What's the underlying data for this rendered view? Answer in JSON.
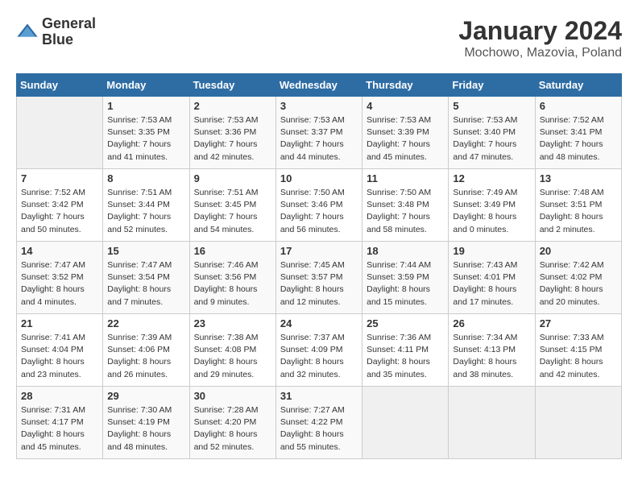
{
  "header": {
    "logo_line1": "General",
    "logo_line2": "Blue",
    "month": "January 2024",
    "location": "Mochowo, Mazovia, Poland"
  },
  "weekdays": [
    "Sunday",
    "Monday",
    "Tuesday",
    "Wednesday",
    "Thursday",
    "Friday",
    "Saturday"
  ],
  "weeks": [
    [
      {
        "day": "",
        "info": ""
      },
      {
        "day": "1",
        "info": "Sunrise: 7:53 AM\nSunset: 3:35 PM\nDaylight: 7 hours\nand 41 minutes."
      },
      {
        "day": "2",
        "info": "Sunrise: 7:53 AM\nSunset: 3:36 PM\nDaylight: 7 hours\nand 42 minutes."
      },
      {
        "day": "3",
        "info": "Sunrise: 7:53 AM\nSunset: 3:37 PM\nDaylight: 7 hours\nand 44 minutes."
      },
      {
        "day": "4",
        "info": "Sunrise: 7:53 AM\nSunset: 3:39 PM\nDaylight: 7 hours\nand 45 minutes."
      },
      {
        "day": "5",
        "info": "Sunrise: 7:53 AM\nSunset: 3:40 PM\nDaylight: 7 hours\nand 47 minutes."
      },
      {
        "day": "6",
        "info": "Sunrise: 7:52 AM\nSunset: 3:41 PM\nDaylight: 7 hours\nand 48 minutes."
      }
    ],
    [
      {
        "day": "7",
        "info": "Sunrise: 7:52 AM\nSunset: 3:42 PM\nDaylight: 7 hours\nand 50 minutes."
      },
      {
        "day": "8",
        "info": "Sunrise: 7:51 AM\nSunset: 3:44 PM\nDaylight: 7 hours\nand 52 minutes."
      },
      {
        "day": "9",
        "info": "Sunrise: 7:51 AM\nSunset: 3:45 PM\nDaylight: 7 hours\nand 54 minutes."
      },
      {
        "day": "10",
        "info": "Sunrise: 7:50 AM\nSunset: 3:46 PM\nDaylight: 7 hours\nand 56 minutes."
      },
      {
        "day": "11",
        "info": "Sunrise: 7:50 AM\nSunset: 3:48 PM\nDaylight: 7 hours\nand 58 minutes."
      },
      {
        "day": "12",
        "info": "Sunrise: 7:49 AM\nSunset: 3:49 PM\nDaylight: 8 hours\nand 0 minutes."
      },
      {
        "day": "13",
        "info": "Sunrise: 7:48 AM\nSunset: 3:51 PM\nDaylight: 8 hours\nand 2 minutes."
      }
    ],
    [
      {
        "day": "14",
        "info": "Sunrise: 7:47 AM\nSunset: 3:52 PM\nDaylight: 8 hours\nand 4 minutes."
      },
      {
        "day": "15",
        "info": "Sunrise: 7:47 AM\nSunset: 3:54 PM\nDaylight: 8 hours\nand 7 minutes."
      },
      {
        "day": "16",
        "info": "Sunrise: 7:46 AM\nSunset: 3:56 PM\nDaylight: 8 hours\nand 9 minutes."
      },
      {
        "day": "17",
        "info": "Sunrise: 7:45 AM\nSunset: 3:57 PM\nDaylight: 8 hours\nand 12 minutes."
      },
      {
        "day": "18",
        "info": "Sunrise: 7:44 AM\nSunset: 3:59 PM\nDaylight: 8 hours\nand 15 minutes."
      },
      {
        "day": "19",
        "info": "Sunrise: 7:43 AM\nSunset: 4:01 PM\nDaylight: 8 hours\nand 17 minutes."
      },
      {
        "day": "20",
        "info": "Sunrise: 7:42 AM\nSunset: 4:02 PM\nDaylight: 8 hours\nand 20 minutes."
      }
    ],
    [
      {
        "day": "21",
        "info": "Sunrise: 7:41 AM\nSunset: 4:04 PM\nDaylight: 8 hours\nand 23 minutes."
      },
      {
        "day": "22",
        "info": "Sunrise: 7:39 AM\nSunset: 4:06 PM\nDaylight: 8 hours\nand 26 minutes."
      },
      {
        "day": "23",
        "info": "Sunrise: 7:38 AM\nSunset: 4:08 PM\nDaylight: 8 hours\nand 29 minutes."
      },
      {
        "day": "24",
        "info": "Sunrise: 7:37 AM\nSunset: 4:09 PM\nDaylight: 8 hours\nand 32 minutes."
      },
      {
        "day": "25",
        "info": "Sunrise: 7:36 AM\nSunset: 4:11 PM\nDaylight: 8 hours\nand 35 minutes."
      },
      {
        "day": "26",
        "info": "Sunrise: 7:34 AM\nSunset: 4:13 PM\nDaylight: 8 hours\nand 38 minutes."
      },
      {
        "day": "27",
        "info": "Sunrise: 7:33 AM\nSunset: 4:15 PM\nDaylight: 8 hours\nand 42 minutes."
      }
    ],
    [
      {
        "day": "28",
        "info": "Sunrise: 7:31 AM\nSunset: 4:17 PM\nDaylight: 8 hours\nand 45 minutes."
      },
      {
        "day": "29",
        "info": "Sunrise: 7:30 AM\nSunset: 4:19 PM\nDaylight: 8 hours\nand 48 minutes."
      },
      {
        "day": "30",
        "info": "Sunrise: 7:28 AM\nSunset: 4:20 PM\nDaylight: 8 hours\nand 52 minutes."
      },
      {
        "day": "31",
        "info": "Sunrise: 7:27 AM\nSunset: 4:22 PM\nDaylight: 8 hours\nand 55 minutes."
      },
      {
        "day": "",
        "info": ""
      },
      {
        "day": "",
        "info": ""
      },
      {
        "day": "",
        "info": ""
      }
    ]
  ]
}
